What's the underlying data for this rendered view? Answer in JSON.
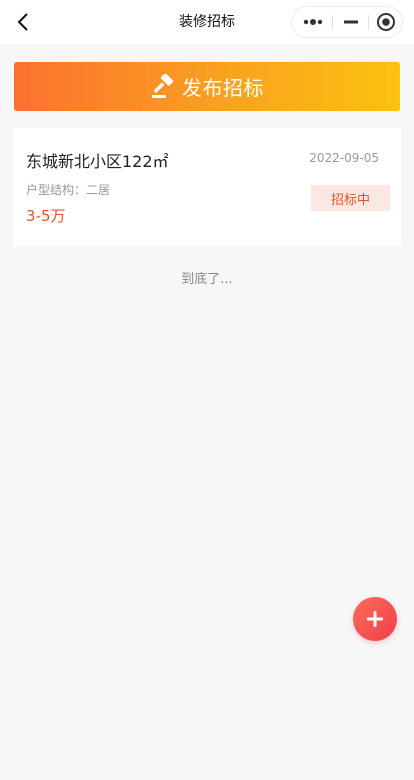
{
  "navbar": {
    "title": "装修招标",
    "back_icon": "chevron-left-icon",
    "capsule": {
      "more_icon": "more-dots-icon",
      "minimize_icon": "minimize-icon",
      "close_icon": "target-circle-icon"
    }
  },
  "publish": {
    "label": "发布招标",
    "icon": "gavel-icon"
  },
  "listing": {
    "title": "东城新北小区122㎡",
    "date": "2022-09-05",
    "layout": "户型结构：二居",
    "price": "3-5万",
    "status": "招标中"
  },
  "footer": {
    "end_text": "到底了..."
  },
  "fab": {
    "icon": "plus-icon"
  },
  "colors": {
    "accent": "#e8551f",
    "gradient_start": "#fb7130",
    "gradient_end": "#fbc20f",
    "fab": "#ef3f4a"
  }
}
